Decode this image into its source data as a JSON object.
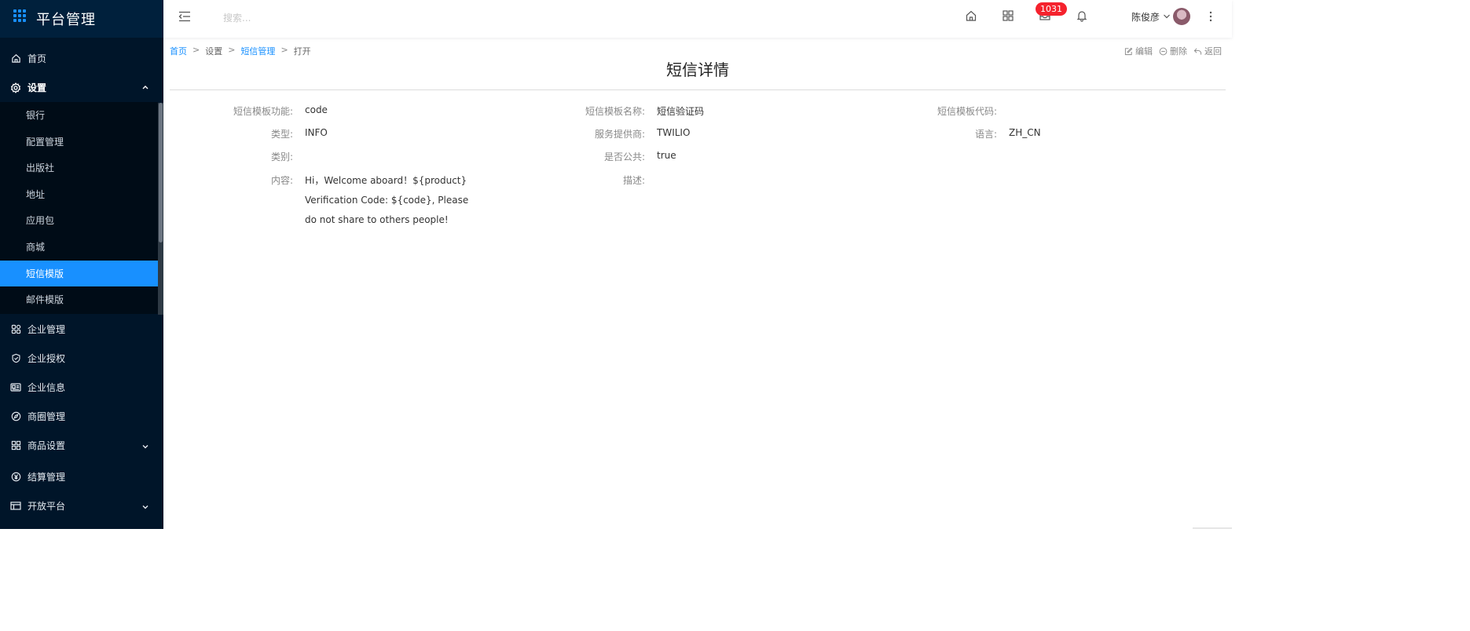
{
  "app": {
    "title": "平台管理"
  },
  "sidebar": {
    "home": "首页",
    "settings": "设置",
    "settings_items": [
      "银行",
      "配置管理",
      "出版社",
      "地址",
      "应用包",
      "商城",
      "短信模版",
      "邮件模版"
    ],
    "active_item": "短信模版",
    "enterprise_mgmt": "企业管理",
    "enterprise_auth": "企业授权",
    "enterprise_info": "企业信息",
    "business_circle": "商圈管理",
    "product_settings": "商品设置",
    "settlement": "结算管理",
    "open_platform": "开放平台"
  },
  "header": {
    "search_placeholder": "搜索...",
    "badge_count": "1031",
    "user_name": "陈俊彦"
  },
  "breadcrumb": {
    "home": "首页",
    "settings": "设置",
    "sms_mgmt": "短信管理",
    "current": "打开",
    "sep": ">"
  },
  "actions": {
    "edit": "编辑",
    "delete": "删除",
    "back": "返回"
  },
  "page": {
    "title": "短信详情"
  },
  "fields": {
    "function_label": "短信模板功能:",
    "function_value": "code",
    "name_label": "短信模板名称:",
    "name_value": "短信验证码",
    "code_label": "短信模板代码:",
    "code_value": "",
    "type_label": "类型:",
    "type_value": "INFO",
    "provider_label": "服务提供商:",
    "provider_value": "TWILIO",
    "language_label": "语言:",
    "language_value": "ZH_CN",
    "category_label": "类别:",
    "category_value": "",
    "public_label": "是否公共:",
    "public_value": "true",
    "content_label": "内容:",
    "content_value": "Hi，Welcome aboard！${product} Verification Code: ${code}, Please do not share to others people!",
    "description_label": "描述:",
    "description_value": ""
  },
  "colors": {
    "sidebar_bg": "#001529",
    "submenu_bg": "#000c17",
    "accent": "#1890ff",
    "badge": "#f5222d"
  }
}
